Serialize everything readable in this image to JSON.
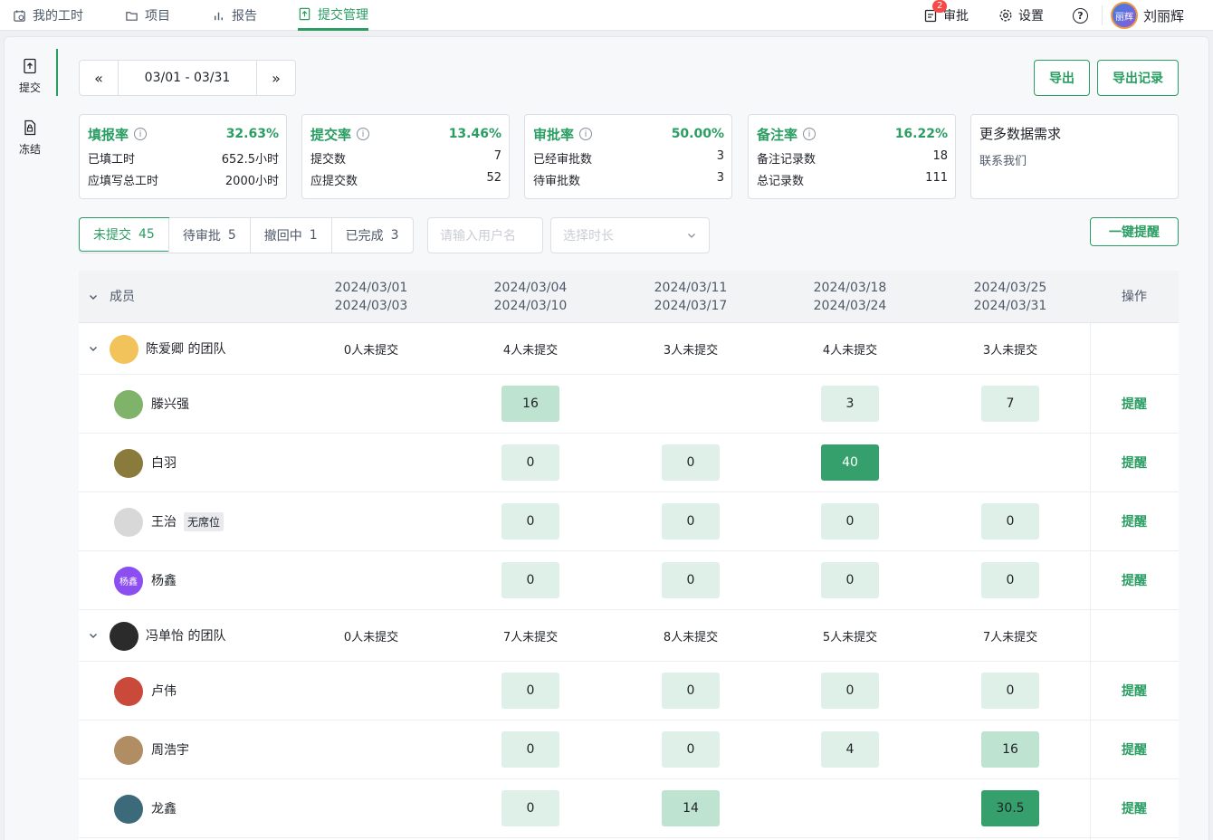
{
  "nav": {
    "tabs": [
      {
        "label": "我的工时"
      },
      {
        "label": "项目"
      },
      {
        "label": "报告"
      },
      {
        "label": "提交管理"
      }
    ],
    "approve": {
      "label": "审批",
      "badge": "2"
    },
    "settings": "设置",
    "user": {
      "name": "刘丽辉",
      "avatar_text": "丽辉"
    }
  },
  "side": {
    "submit": "提交",
    "freeze": "冻结"
  },
  "date_range": "03/01 - 03/31",
  "buttons": {
    "export": "导出",
    "export_log": "导出记录",
    "remind_all": "一键提醒"
  },
  "stats": [
    {
      "title": "填报率",
      "pct": "32.63%",
      "rows": [
        [
          "已填工时",
          "652.5小时"
        ],
        [
          "应填写总工时",
          "2000小时"
        ]
      ]
    },
    {
      "title": "提交率",
      "pct": "13.46%",
      "rows": [
        [
          "提交数",
          "7"
        ],
        [
          "应提交数",
          "52"
        ]
      ]
    },
    {
      "title": "审批率",
      "pct": "50.00%",
      "rows": [
        [
          "已经审批数",
          "3"
        ],
        [
          "待审批数",
          "3"
        ]
      ]
    },
    {
      "title": "备注率",
      "pct": "16.22%",
      "rows": [
        [
          "备注记录数",
          "18"
        ],
        [
          "总记录数",
          "111"
        ]
      ]
    }
  ],
  "more": {
    "title": "更多数据需求",
    "sub": "联系我们"
  },
  "filters": [
    {
      "label": "未提交",
      "count": "45"
    },
    {
      "label": "待审批",
      "count": "5"
    },
    {
      "label": "撤回中",
      "count": "1"
    },
    {
      "label": "已完成",
      "count": "3"
    }
  ],
  "search_placeholder": "请输入用户名",
  "duration_placeholder": "选择时长",
  "table": {
    "member_header": "成员",
    "op_header": "操作",
    "weeks": [
      [
        "2024/03/01",
        "2024/03/03"
      ],
      [
        "2024/03/04",
        "2024/03/10"
      ],
      [
        "2024/03/11",
        "2024/03/17"
      ],
      [
        "2024/03/18",
        "2024/03/24"
      ],
      [
        "2024/03/25",
        "2024/03/31"
      ]
    ],
    "remind": "提醒",
    "rows": [
      {
        "type": "team",
        "name": "陈爱卿 的团队",
        "cells": [
          "0人未提交",
          "4人未提交",
          "3人未提交",
          "4人未提交",
          "3人未提交"
        ],
        "avatar_color": "#f3c35b"
      },
      {
        "type": "member",
        "name": "滕兴强",
        "cells": [
          "",
          "16",
          "",
          "3",
          "7"
        ],
        "avatar_color": "#7fb36a"
      },
      {
        "type": "member",
        "name": "白羽",
        "cells": [
          "",
          "0",
          "0",
          "40",
          ""
        ],
        "avatar_color": "#8a7a3c"
      },
      {
        "type": "member",
        "name": "王治",
        "tag": "无席位",
        "cells": [
          "",
          "0",
          "0",
          "0",
          "0"
        ],
        "avatar_color": "#d8d8d8"
      },
      {
        "type": "member",
        "name": "杨鑫",
        "avatar_text": "杨鑫",
        "cells": [
          "",
          "0",
          "0",
          "0",
          "0"
        ],
        "avatar_color": "#8b4ef0"
      },
      {
        "type": "team",
        "name": "冯单怡 的团队",
        "cells": [
          "0人未提交",
          "7人未提交",
          "8人未提交",
          "5人未提交",
          "7人未提交"
        ],
        "avatar_color": "#2b2b2b"
      },
      {
        "type": "member",
        "name": "卢伟",
        "cells": [
          "",
          "0",
          "0",
          "0",
          "0"
        ],
        "avatar_color": "#c94a3a"
      },
      {
        "type": "member",
        "name": "周浩宇",
        "cells": [
          "",
          "0",
          "0",
          "4",
          "16"
        ],
        "avatar_color": "#b08d63"
      },
      {
        "type": "member",
        "name": "龙鑫",
        "cells": [
          "",
          "0",
          "14",
          "",
          "30.5"
        ],
        "avatar_color": "#3c6a7a"
      }
    ]
  },
  "colors": {
    "accent": "#2a9d62",
    "chip_light": "#dff0e9",
    "chip_mid": "#bfe3d1",
    "chip_dark": "#35a06b"
  }
}
